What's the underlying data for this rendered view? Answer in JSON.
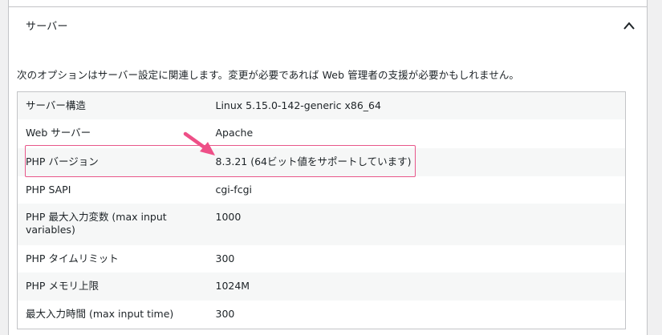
{
  "section": {
    "title": "サーバー",
    "collapse_icon": "chevron-up-icon",
    "description": "次のオプションはサーバー設定に関連します。変更が必要であれば Web 管理者の支援が必要かもしれません。"
  },
  "rows": [
    {
      "label": "サーバー構造",
      "value": "Linux 5.15.0-142-generic x86_64"
    },
    {
      "label": "Web サーバー",
      "value": "Apache"
    },
    {
      "label": "PHP バージョン",
      "value": "8.3.21 (64ビット値をサポートしています)"
    },
    {
      "label": "PHP SAPI",
      "value": "cgi-fcgi"
    },
    {
      "label": "PHP 最大入力変数 (max input variables)",
      "value": "1000"
    },
    {
      "label": "PHP タイムリミット",
      "value": "300"
    },
    {
      "label": "PHP メモリ上限",
      "value": "1024M"
    },
    {
      "label": "最大入力時間 (max input time)",
      "value": "300"
    }
  ],
  "colors": {
    "highlight": "#e8578a",
    "arrow": "#ee4f87",
    "stripe": "#f6f7f7",
    "border": "#c3c4c7"
  }
}
